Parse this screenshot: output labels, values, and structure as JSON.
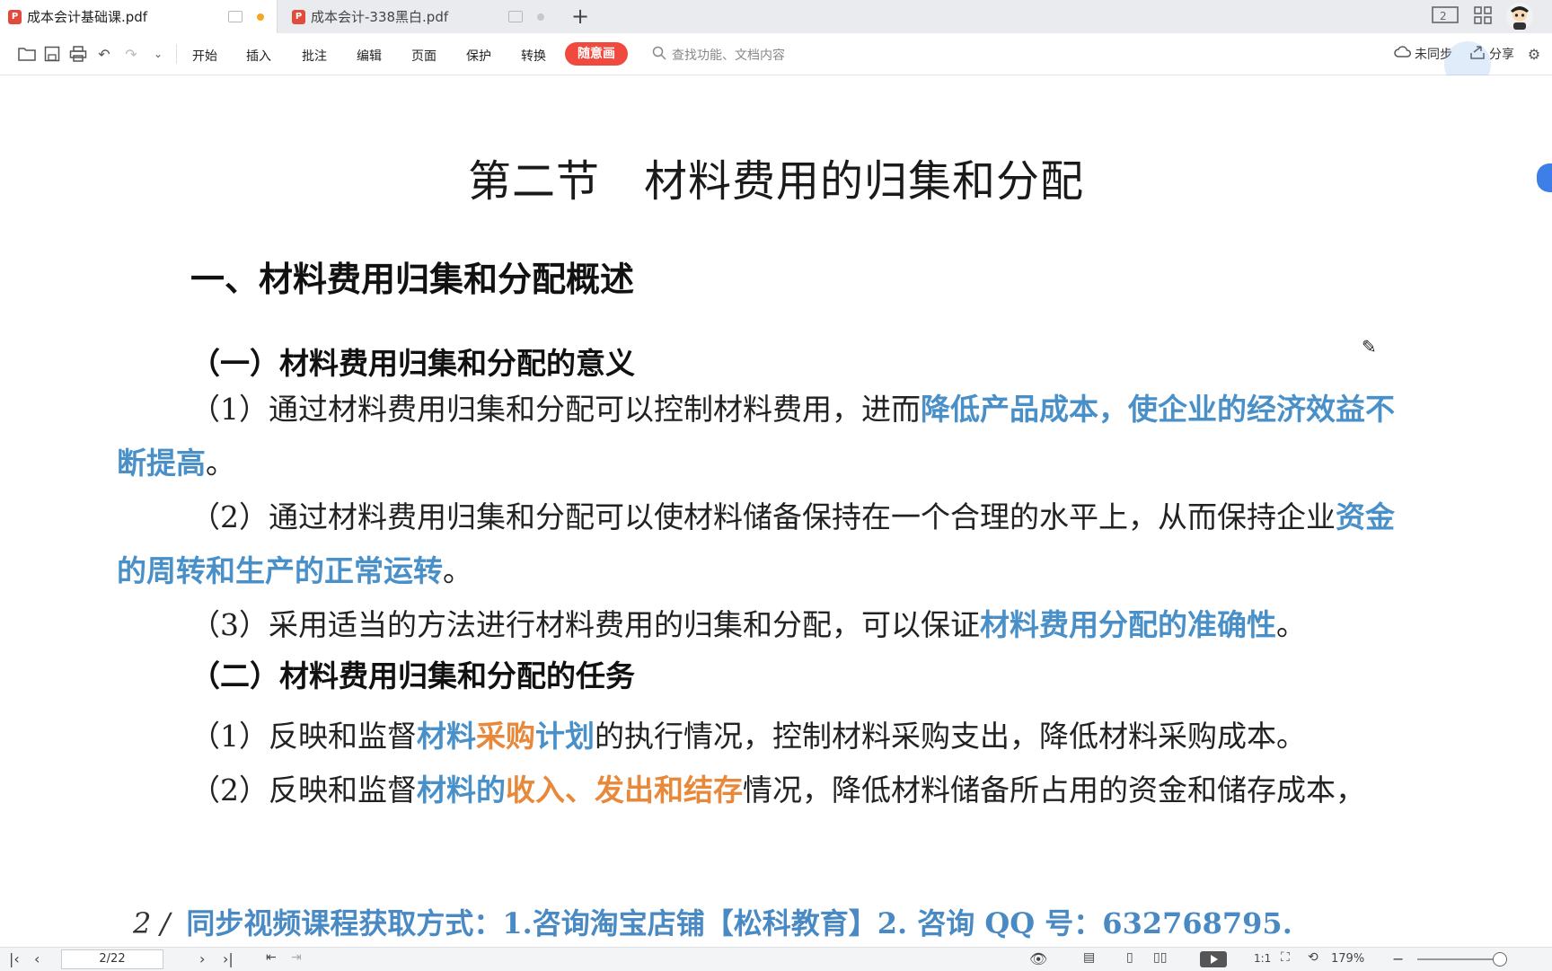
{
  "tabs": [
    {
      "label": "成本会计基础课.pdf",
      "active": true,
      "dot_color": "#f5a623"
    },
    {
      "label": "成本会计-338黑白.pdf",
      "active": false,
      "dot_color": "#c5c8cc"
    }
  ],
  "new_tab": "+",
  "toolbar": {
    "menus": [
      "开始",
      "插入",
      "批注",
      "编辑",
      "页面",
      "保护",
      "转换"
    ],
    "highlight_btn": "随意画",
    "search_placeholder": "查找功能、文档内容",
    "sync": "未同步",
    "share": "分享"
  },
  "document": {
    "title": "第二节　材料费用的归集和分配",
    "h1": "一、材料费用归集和分配概述",
    "section1": {
      "heading": "（一）材料费用归集和分配的意义",
      "p1_a": "（1）通过材料费用归集和分配可以控制材料费用，进而",
      "p1_b": "降低产品成本，使企业的经济效",
      "p1_c": "益不断提高",
      "p1_d": "。",
      "p2_a": "（2）通过材料费用归集和分配可以使材料储备保持在一个合理的水平上，从而保持企业",
      "p2_b": "资金的周转和生产的正常运转",
      "p2_c": "。",
      "p3_a": "（3）采用适当的方法进行材料费用的归集和分配，可以保证",
      "p3_b": "材料费用分配的准确性",
      "p3_c": "。"
    },
    "section2": {
      "heading": "（二）材料费用归集和分配的任务",
      "t1_a": "（1）反映和监督",
      "t1_b": "材料",
      "t1_c": "采购",
      "t1_d": "计划",
      "t1_e": "的执行情况，控制材料采购支出，降低材料采购成本。",
      "t2_a": "（2）反映和监督",
      "t2_b": "材料的",
      "t2_c": "收入、发出和结存",
      "t2_d": "情况，降低材料储备所占用的资金和储存成本，"
    },
    "footer_page": "2 /",
    "footer_text": "同步视频课程获取方式：1.咨询淘宝店铺【松科教育】2. 咨询 QQ 号：632768795."
  },
  "statusbar": {
    "page_indicator": "2/22",
    "zoom": "179%"
  },
  "colors": {
    "highlight_blue": "#4a90c8",
    "highlight_orange": "#e8883a",
    "accent_red": "#f0493e"
  }
}
